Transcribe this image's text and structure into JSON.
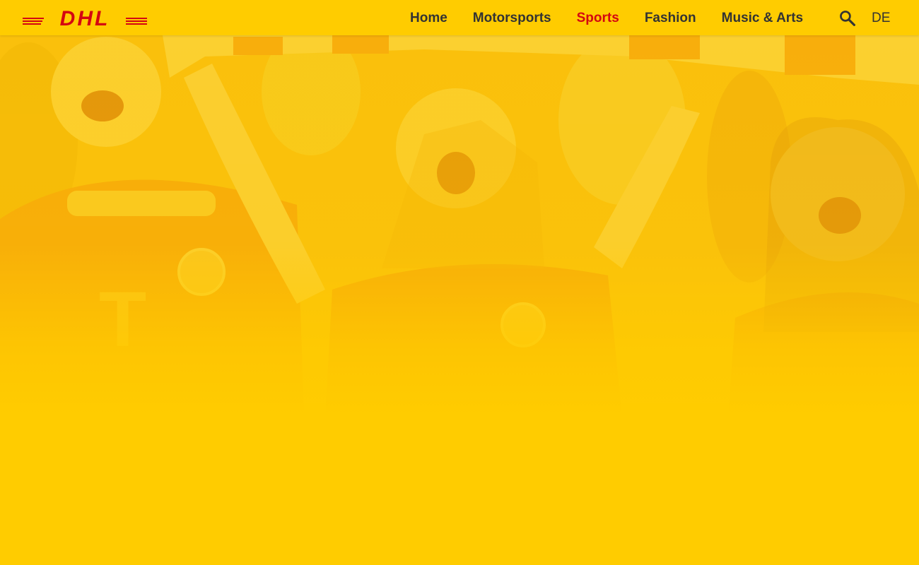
{
  "brand": {
    "logo_text": "DHL",
    "colors": {
      "primary_yellow": "#ffcc00",
      "brand_red": "#d40511",
      "nav_text": "#333333"
    }
  },
  "nav": {
    "items": [
      {
        "label": "Home",
        "active": false
      },
      {
        "label": "Motorsports",
        "active": false
      },
      {
        "label": "Sports",
        "active": true
      },
      {
        "label": "Fashion",
        "active": false
      },
      {
        "label": "Music & Arts",
        "active": false
      }
    ],
    "search_icon": "search-icon",
    "language": "DE"
  },
  "hero": {
    "image_subject": "cheering-football-fans-photo"
  }
}
